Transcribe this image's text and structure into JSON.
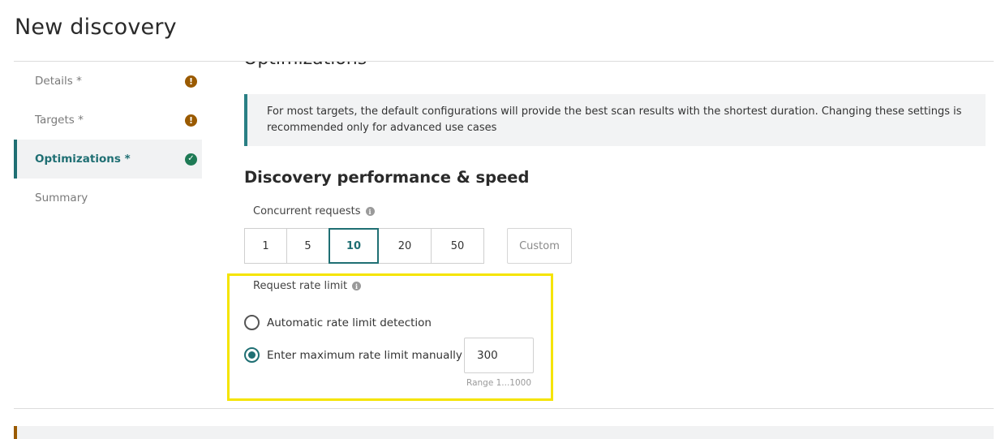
{
  "page": {
    "title": "New discovery"
  },
  "sidebar": {
    "steps": [
      {
        "label": "Details *",
        "status": "warning"
      },
      {
        "label": "Targets *",
        "status": "warning"
      },
      {
        "label": "Optimizations *",
        "status": "complete",
        "active": true
      },
      {
        "label": "Summary",
        "status": "none"
      }
    ],
    "warning_glyph": "!",
    "complete_glyph": "✓"
  },
  "main": {
    "section_title": "Optimizations",
    "info_text": "For most targets, the default configurations will provide the best scan results with the shortest duration. Changing these settings is recommended only for advanced use cases",
    "performance_heading": "Discovery performance & speed",
    "concurrent": {
      "label": "Concurrent requests",
      "options": [
        "1",
        "5",
        "10",
        "20",
        "50"
      ],
      "selected": "10",
      "custom_label": "Custom"
    },
    "rate_limit": {
      "label": "Request rate limit",
      "auto_label": "Automatic rate limit detection",
      "manual_label": "Enter maximum rate limit manually",
      "selected": "manual",
      "value": "300",
      "range_hint": "Range 1...1000"
    }
  },
  "colors": {
    "accent": "#1f6f73",
    "warning": "#9a5a00",
    "success": "#1e7a55",
    "highlight": "#f5e400"
  }
}
